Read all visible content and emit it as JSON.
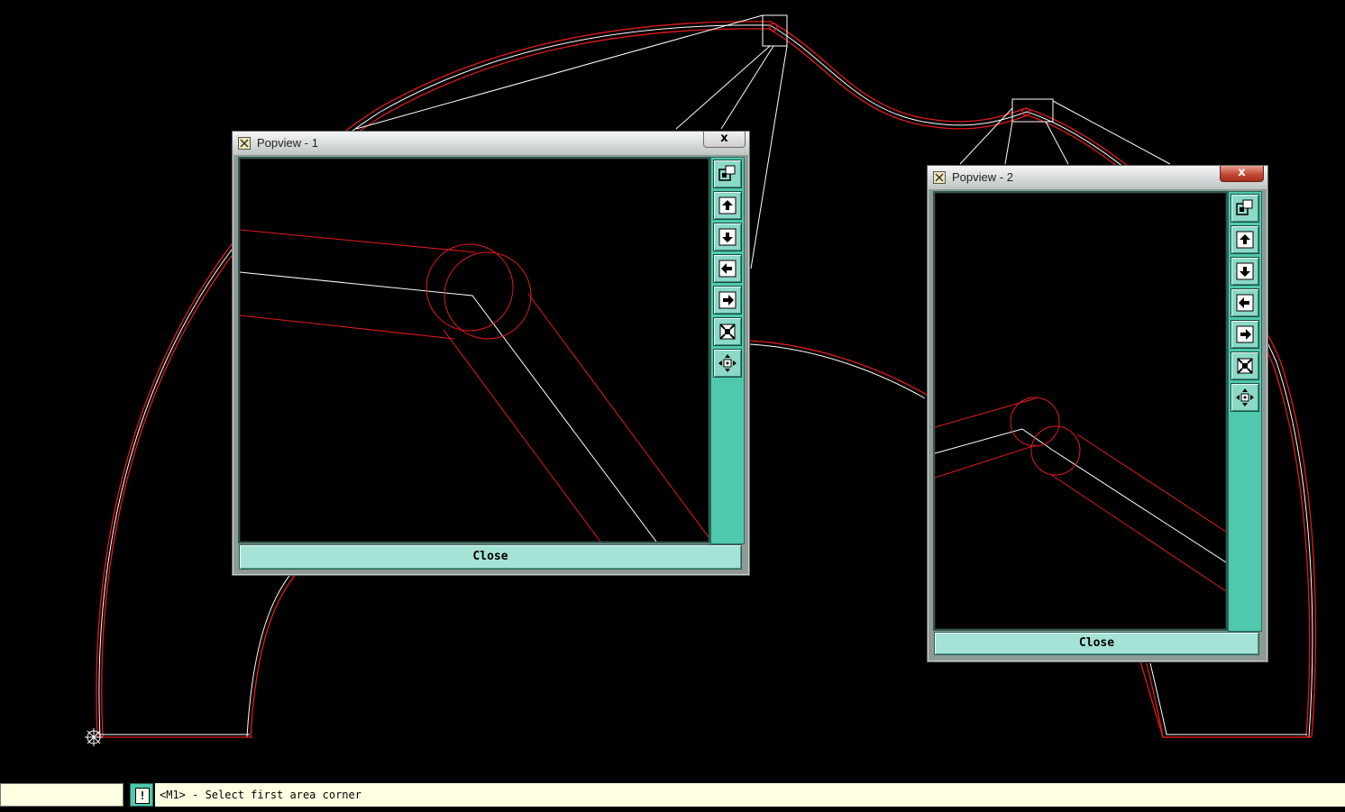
{
  "popview1": {
    "title": "Popview - 1",
    "close_glyph": "x",
    "close_button": "Close",
    "tools": [
      "zoom-window-icon",
      "pan-up-icon",
      "pan-down-icon",
      "pan-left-icon",
      "pan-right-icon",
      "zoom-fit-icon",
      "zoom-center-icon"
    ]
  },
  "popview2": {
    "title": "Popview - 2",
    "close_glyph": "x",
    "close_button": "Close",
    "tools": [
      "zoom-window-icon",
      "pan-up-icon",
      "pan-down-icon",
      "pan-left-icon",
      "pan-right-icon",
      "zoom-fit-icon",
      "zoom-center-icon"
    ]
  },
  "statusbar": {
    "input_value": "",
    "warning_glyph": "!",
    "prompt": "<M1> - Select first area corner"
  },
  "colors": {
    "background": "#000000",
    "outline_red": "#ff2020",
    "centerline_white": "#ffffff",
    "toolstrip": "#4fc9ad",
    "prompt_bg": "#ffffe1"
  }
}
